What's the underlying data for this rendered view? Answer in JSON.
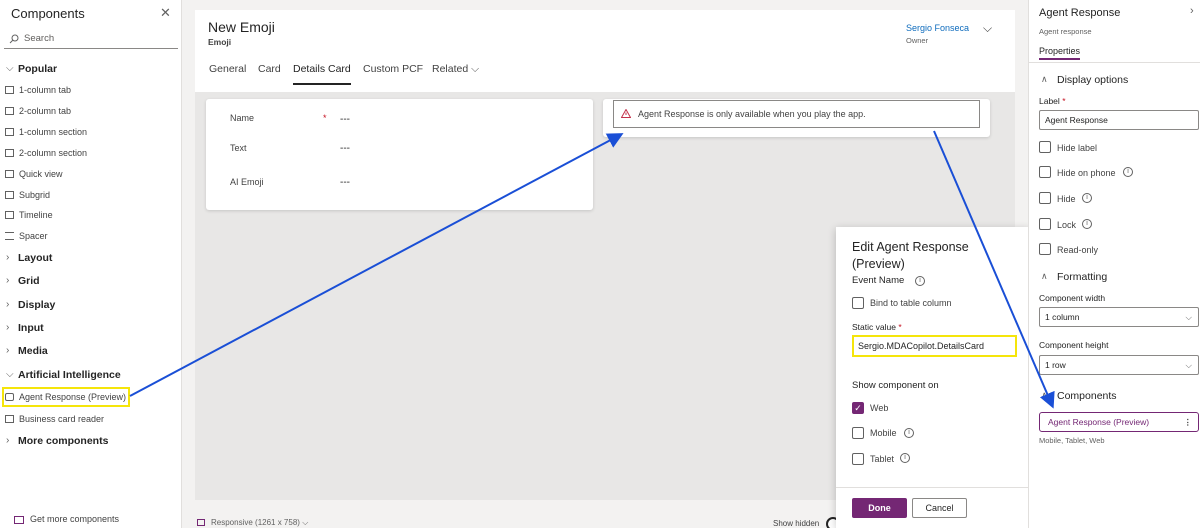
{
  "left_panel": {
    "title": "Components",
    "search_placeholder": "Search",
    "popular_label": "Popular",
    "popular_items": [
      "1-column tab",
      "2-column tab",
      "1-column section",
      "2-column section",
      "Quick view",
      "Subgrid",
      "Timeline",
      "Spacer"
    ],
    "groups": [
      "Layout",
      "Grid",
      "Display",
      "Input",
      "Media"
    ],
    "ai_label": "Artificial Intelligence",
    "ai_items": [
      "Agent Response (Preview)",
      "Business card reader"
    ],
    "more_label": "More components",
    "get_more": "Get more components"
  },
  "header": {
    "record_title": "New Emoji",
    "record_subtitle": "Emoji",
    "owner_name": "Sergio Fonseca",
    "owner_label": "Owner",
    "tabs": [
      "General",
      "Card",
      "Details Card",
      "Custom PCF",
      "Related"
    ],
    "active_tab": "Details Card"
  },
  "form": {
    "fields": [
      {
        "label": "Name",
        "value": "---",
        "required": true
      },
      {
        "label": "Text",
        "value": "---"
      },
      {
        "label": "AI Emoji",
        "value": "---"
      }
    ],
    "required_marker": "*",
    "warning": "Agent Response is only available when you play the app."
  },
  "status_bar": {
    "responsive": "Responsive (1261 x 758)",
    "show_hidden": "Show hidden"
  },
  "popup": {
    "title": "Edit Agent Response (Preview)",
    "event_name_label": "Event Name",
    "bind_label": "Bind to table column",
    "static_value_label": "Static value",
    "required_marker": "*",
    "static_value": "Sergio.MDACopilot.DetailsCard",
    "show_on_label": "Show component on",
    "platforms": [
      {
        "label": "Web",
        "checked": true
      },
      {
        "label": "Mobile",
        "checked": false
      },
      {
        "label": "Tablet",
        "checked": false
      }
    ],
    "done_label": "Done",
    "cancel_label": "Cancel"
  },
  "right_panel": {
    "title": "Agent Response",
    "subtitle": "Agent response",
    "properties_tab": "Properties",
    "display_options": "Display options",
    "label_label": "Label",
    "required_marker": "*",
    "label_value": "Agent Response",
    "checkboxes": [
      "Hide label",
      "Hide on phone",
      "Hide",
      "Lock",
      "Read-only"
    ],
    "formatting": "Formatting",
    "width_label": "Component width",
    "width_value": "1 column",
    "height_label": "Component height",
    "height_value": "1 row",
    "components_label": "Components",
    "component_item": "Agent Response (Preview)",
    "component_platforms": "Mobile, Tablet, Web"
  },
  "colors": {
    "accent": "#742774",
    "highlight": "#f5e50a",
    "arrow": "#1a4fd6",
    "link": "#0f6cbd"
  }
}
